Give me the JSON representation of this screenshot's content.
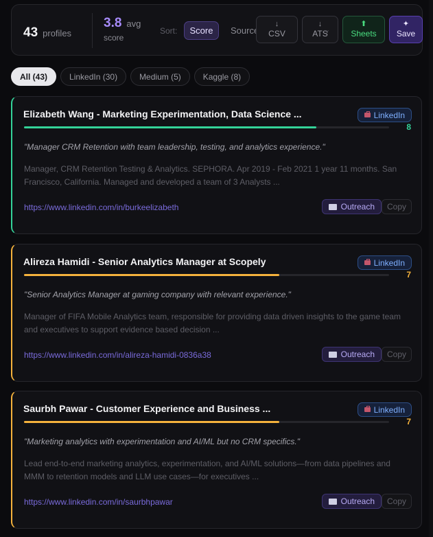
{
  "stats": {
    "profile_count": "43",
    "profile_label": "profiles",
    "avg_score": "3.8",
    "avg_label": "avg",
    "avg_sub": "score"
  },
  "toolbar": {
    "sort_label": "Sort:",
    "sort_value": "Score",
    "source_label": "Source",
    "csv": {
      "icon": "download-icon",
      "glyph": "↓",
      "label": "CSV"
    },
    "ats": {
      "icon": "download-icon",
      "glyph": "↓",
      "label": "ATS",
      "caret": "˅"
    },
    "sheets": {
      "icon": "upload-icon",
      "glyph": "⬆",
      "label": "Sheets"
    },
    "save": {
      "icon": "sparkle-icon",
      "glyph": "✦",
      "label": "Save"
    }
  },
  "filters": [
    {
      "label": "All (43)",
      "active": true
    },
    {
      "label": "LinkedIn (30)",
      "active": false
    },
    {
      "label": "Medium (5)",
      "active": false
    },
    {
      "label": "Kaggle (8)",
      "active": false
    }
  ],
  "profiles": [
    {
      "title": "Elizabeth Wang - Marketing Experimentation, Data Science ...",
      "source": "LinkedIn",
      "source_icon": "briefcase-icon",
      "score": "8",
      "score_fraction": 0.8,
      "accent": "#34d399",
      "summary": "\"Manager CRM Retention with team leadership, testing, and analytics experience.\"",
      "snippet": "Manager, CRM Retention Testing & Analytics. SEPHORA. Apr 2019 - Feb 2021 1 year 11 months. San Francisco, California. Managed and developed a team of 3 Analysts ...",
      "url": "https://www.linkedin.com/in/burkeelizabeth",
      "outreach_label": "Outreach",
      "copy_label": "Copy"
    },
    {
      "title": "Alireza Hamidi - Senior Analytics Manager at Scopely",
      "source": "LinkedIn",
      "source_icon": "briefcase-icon",
      "score": "7",
      "score_fraction": 0.7,
      "accent": "#f5b23c",
      "summary": "\"Senior Analytics Manager at gaming company with relevant experience.\"",
      "snippet": "Manager of FIFA Mobile Analytics team, responsible for providing data driven insights to the game team and executives to support evidence based decision ...",
      "url": "https://www.linkedin.com/in/alireza-hamidi-0836a38",
      "outreach_label": "Outreach",
      "copy_label": "Copy"
    },
    {
      "title": "Saurbh Pawar - Customer Experience and Business ...",
      "source": "LinkedIn",
      "source_icon": "briefcase-icon",
      "score": "7",
      "score_fraction": 0.7,
      "accent": "#f5b23c",
      "summary": "\"Marketing analytics with experimentation and AI/ML but no CRM specifics.\"",
      "snippet": "Lead end-to-end marketing analytics, experimentation, and AI/ML solutions—from data pipelines and MMM to retention models and LLM use cases—for executives ...",
      "url": "https://www.linkedin.com/in/saurbhpawar",
      "outreach_label": "Outreach",
      "copy_label": "Copy"
    }
  ]
}
